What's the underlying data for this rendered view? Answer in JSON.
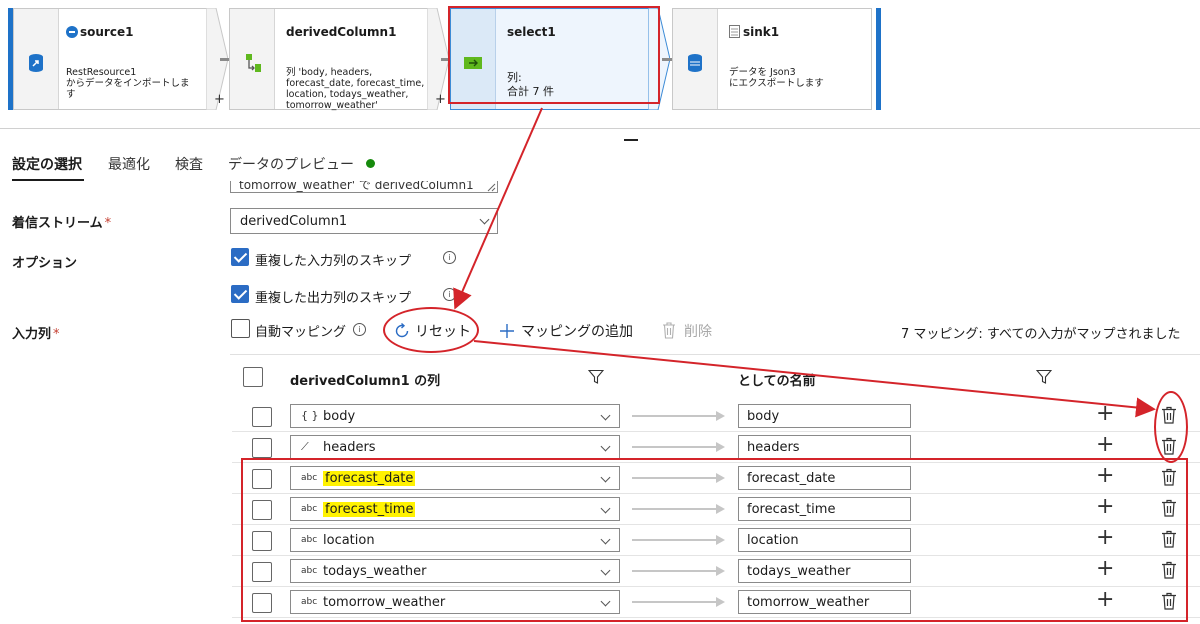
{
  "pipeline": {
    "nodes": [
      {
        "title": "source1",
        "desc": "RestResource1\nからデータをインポートしま\nす"
      },
      {
        "title": "derivedColumn1",
        "desc": "列 'body, headers,\nforecast_date, forecast_time,\nlocation, todays_weather,\ntomorrow_weather'"
      },
      {
        "title": "select1",
        "desc": "列:\n合計 7 件"
      },
      {
        "title": "sink1",
        "desc": "データを Json3\nにエクスポートします"
      }
    ],
    "plus": "+"
  },
  "tabs": [
    {
      "label": "設定の選択"
    },
    {
      "label": "最適化"
    },
    {
      "label": "検査"
    },
    {
      "label": "データのプレビュー"
    }
  ],
  "form": {
    "textarea_tail": "tomorrow_weather' で derivedColumn1",
    "incoming_label": "着信ストリーム",
    "required_mark": "*",
    "incoming_value": "derivedColumn1",
    "options_label": "オプション",
    "skip_input": "重複した入力列のスキップ",
    "skip_output": "重複した出力列のスキップ",
    "input_columns_label": "入力列",
    "auto_mapping": "自動マッピング",
    "reset": "リセット",
    "add_mapping": "マッピングの追加",
    "delete": "削除",
    "mapping_status": "7 マッピング: すべての入力がマップされました"
  },
  "grid": {
    "source_header": "derivedColumn1 の列",
    "dest_header": "としての名前",
    "rows": [
      {
        "type": "{ }",
        "source": "body",
        "dest": "body"
      },
      {
        "type": "⟋",
        "source": "headers",
        "dest": "headers"
      },
      {
        "type": "abc",
        "source": "forecast_date",
        "dest": "forecast_date"
      },
      {
        "type": "abc",
        "source": "forecast_time",
        "dest": "forecast_time"
      },
      {
        "type": "abc",
        "source": "location",
        "dest": "location"
      },
      {
        "type": "abc",
        "source": "todays_weather",
        "dest": "todays_weather"
      },
      {
        "type": "abc",
        "source": "tomorrow_weather",
        "dest": "tomorrow_weather"
      }
    ]
  },
  "colors": {
    "accent": "#2b6cc4",
    "annotation": "#d4242a",
    "highlight": "#fff200",
    "status_ok": "#168a0c"
  }
}
